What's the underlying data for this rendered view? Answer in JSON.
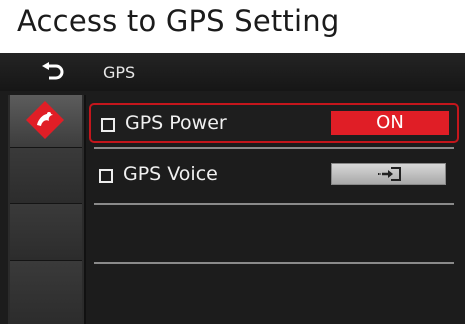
{
  "caption": "Access to GPS Setting",
  "topbar": {
    "title": "GPS",
    "back_icon": "back-arrow-icon"
  },
  "sidebar": {
    "active_icon": "gps-logo-icon"
  },
  "settings": [
    {
      "label": "GPS Power",
      "control": "toggle",
      "value": "ON",
      "selected": true
    },
    {
      "label": "GPS Voice",
      "control": "enter",
      "icon": "enter-icon",
      "selected": false
    }
  ],
  "colors": {
    "accent_red": "#e01e26",
    "selection_border": "#c4161c",
    "background": "#1c1c1c"
  }
}
